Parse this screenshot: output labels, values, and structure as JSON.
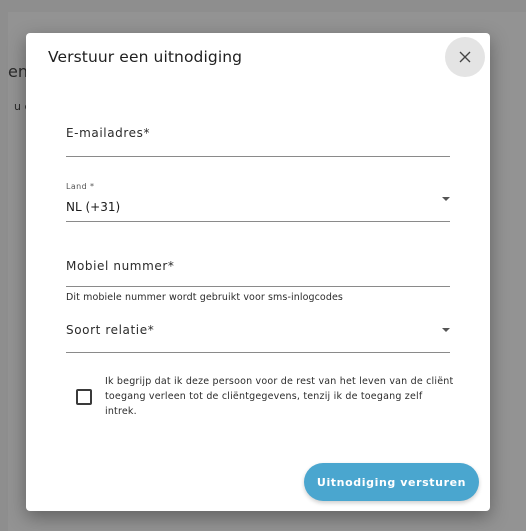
{
  "background": {
    "heading_fragment": "en",
    "sub_fragment": "u c"
  },
  "dialog": {
    "title": "Verstuur een uitnodiging",
    "close_icon": "close-icon"
  },
  "form": {
    "email": {
      "label": "E-mailadres*",
      "value": ""
    },
    "country": {
      "label": "Land *",
      "value": "NL (+31)",
      "icon": "dropdown-arrow-icon"
    },
    "mobile": {
      "label": "Mobiel nummer*",
      "value": "",
      "helper": "Dit mobiele nummer wordt gebruikt voor sms-inlogcodes"
    },
    "relation": {
      "label": "Soort relatie*",
      "value": "",
      "icon": "dropdown-arrow-icon"
    },
    "consent": {
      "checked": false,
      "text": "Ik begrijp dat ik deze persoon voor de rest van het leven van de cliënt toegang verleen tot de cliëntgegevens, tenzij ik de toegang zelf intrek."
    }
  },
  "actions": {
    "submit_label": "Uitnodiging versturen"
  },
  "colors": {
    "backdrop": "#8e8e8e",
    "accent": "#4aa6cf",
    "close_bg": "#e4e4e4"
  }
}
